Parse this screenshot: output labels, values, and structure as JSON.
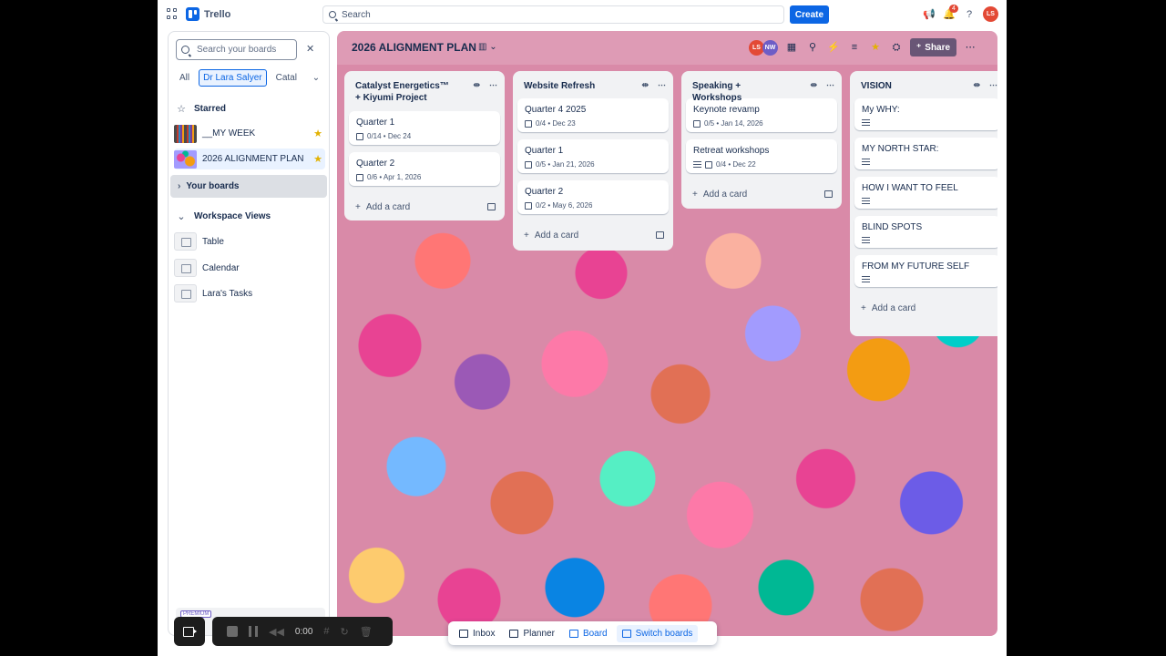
{
  "topbar": {
    "app_name": "Trello",
    "search_placeholder": "Search",
    "create_label": "Create",
    "notification_count": "4",
    "user_initials": "LS"
  },
  "sidebar": {
    "search_placeholder": "Search your boards",
    "filters": [
      "All",
      "Dr Lara Salyer",
      "Catal"
    ],
    "starred_label": "Starred",
    "starred_boards": [
      {
        "name": "__MY WEEK"
      },
      {
        "name": "2026 ALIGNMENT PLAN"
      }
    ],
    "your_boards_label": "Your boards",
    "workspace_views_label": "Workspace Views",
    "views": [
      "Table",
      "Calendar",
      "Lara's Tasks"
    ],
    "premium_label": "PREMIUM"
  },
  "board": {
    "title": "2026 ALIGNMENT PLAN",
    "members": [
      {
        "initials": "LS",
        "color": "#e34935"
      },
      {
        "initials": "NW",
        "color": "#6e5dc6"
      }
    ],
    "share_label": "Share",
    "lists": [
      {
        "title": "Catalyst Energetics™ + Kiyumi Project",
        "cards": [
          {
            "title": "Quarter 1",
            "meta": "0/14 • Dec 24"
          },
          {
            "title": "Quarter 2",
            "meta": "0/6 • Apr 1, 2026"
          }
        ],
        "add_label": "Add a card"
      },
      {
        "title": "Website Refresh",
        "cards": [
          {
            "title": "Quarter 4 2025",
            "meta": "0/4 • Dec 23"
          },
          {
            "title": "Quarter 1",
            "meta": "0/5 • Jan 21, 2026"
          },
          {
            "title": "Quarter 2",
            "meta": "0/2 • May 6, 2026"
          }
        ],
        "add_label": "Add a card"
      },
      {
        "title": "Speaking + Workshops",
        "cards": [
          {
            "title": "Keynote revamp",
            "meta": "0/5 • Jan 14, 2026"
          },
          {
            "title": "Retreat workshops",
            "meta": "0/4 • Dec 22"
          }
        ],
        "add_label": "Add a card"
      },
      {
        "title": "VISION",
        "cards": [
          {
            "title": "My WHY:"
          },
          {
            "title": "MY NORTH STAR:"
          },
          {
            "title": "HOW I WANT TO FEEL"
          },
          {
            "title": "BLIND SPOTS"
          },
          {
            "title": "FROM MY FUTURE SELF"
          }
        ],
        "add_label": "Add a card"
      }
    ]
  },
  "bottom_nav": {
    "items": [
      "Inbox",
      "Planner",
      "Board",
      "Switch boards"
    ]
  },
  "recorder": {
    "time": "0:00"
  }
}
